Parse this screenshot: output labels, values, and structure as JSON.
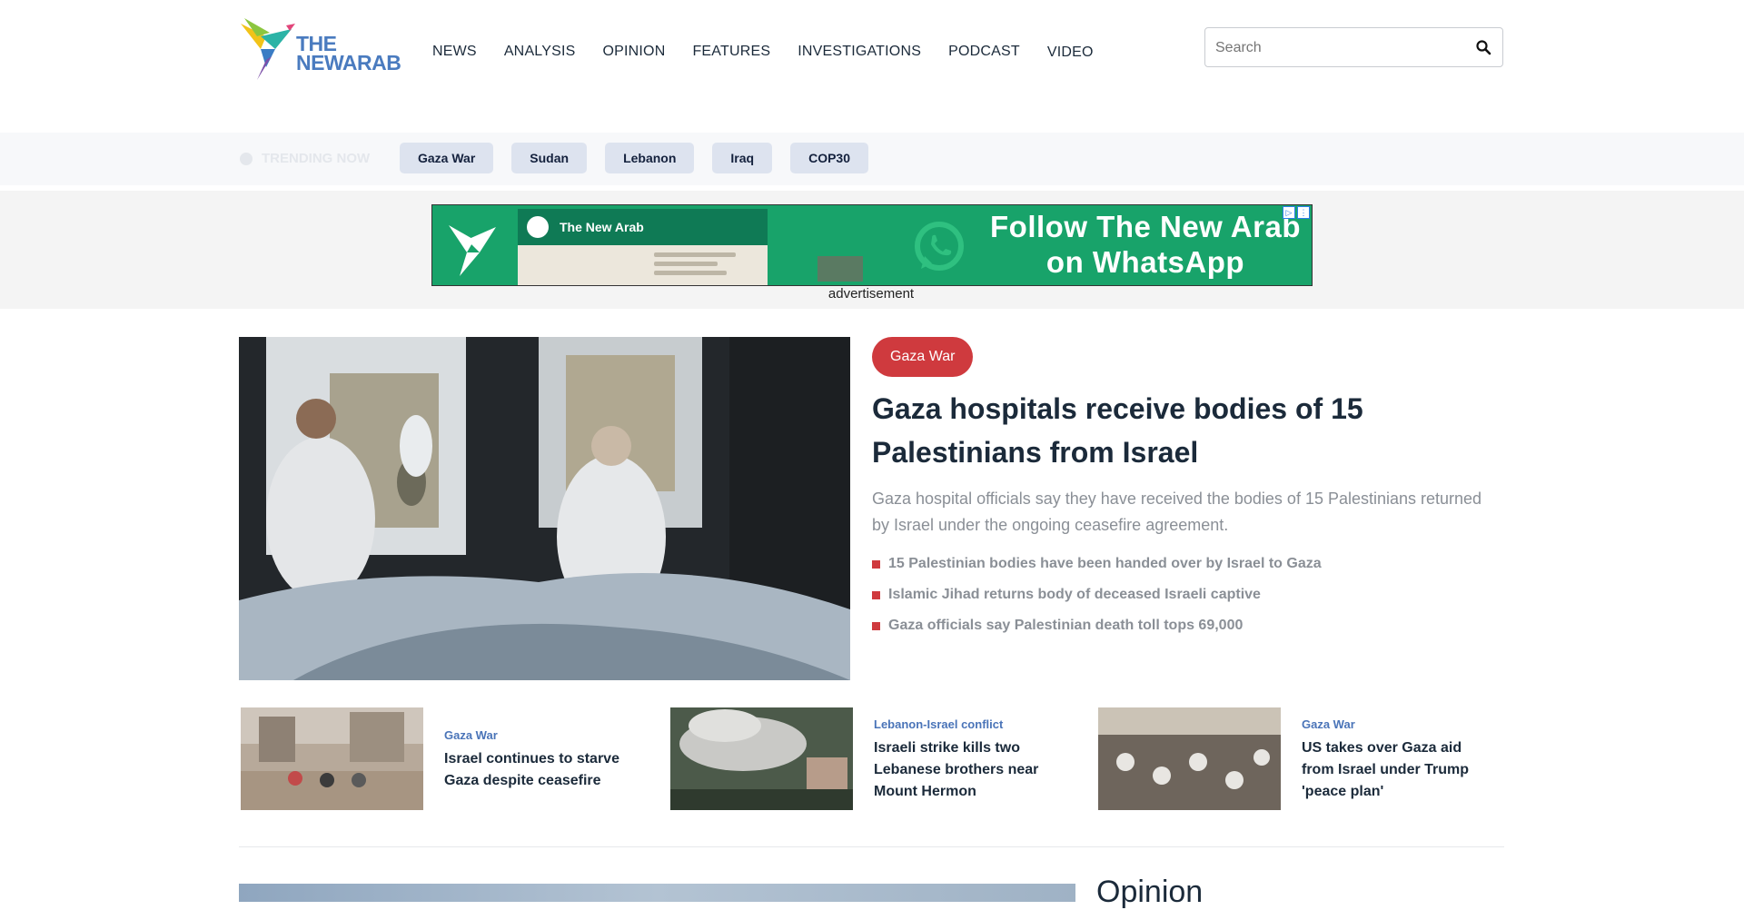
{
  "brand": {
    "line1": "THE",
    "line2": "NEWARAB"
  },
  "nav": [
    "NEWS",
    "ANALYSIS",
    "OPINION",
    "FEATURES",
    "INVESTIGATIONS",
    "PODCAST",
    "VIDEO"
  ],
  "search": {
    "placeholder": "Search"
  },
  "trending": {
    "label": "TRENDING NOW",
    "topics": [
      "Gaza War",
      "Sudan",
      "Lebanon",
      "Iraq",
      "COP30"
    ]
  },
  "ad": {
    "brand_name": "The New Arab",
    "headline": "Follow The New Arab on WhatsApp",
    "caption": "advertisement"
  },
  "hero": {
    "tag": "Gaza War",
    "title": "Gaza hospitals receive bodies of 15 Palestinians from Israel",
    "summary": "Gaza hospital officials say they have received the bodies of 15 Palestinians returned by Israel under the ongoing ceasefire agreement.",
    "bullets": [
      "15 Palestinian bodies have been handed over by Israel to Gaza",
      "Islamic Jihad returns body of deceased Israeli captive",
      "Gaza officials say Palestinian death toll tops 69,000"
    ]
  },
  "cards": [
    {
      "tag": "Gaza War",
      "title": "Israel continues to starve Gaza despite ceasefire"
    },
    {
      "tag": "Lebanon-Israel conflict",
      "title": "Israeli strike kills two Lebanese brothers near Mount Hermon"
    },
    {
      "tag": "Gaza War",
      "title": "US takes over Gaza aid from Israel under Trump 'peace plan'"
    }
  ],
  "opinion": {
    "heading": "Opinion"
  },
  "colors": {
    "accent_red": "#cf3a3e",
    "link_blue": "#4a74b8",
    "ad_green": "#18a36a",
    "chip_bg": "#dde3ef"
  }
}
